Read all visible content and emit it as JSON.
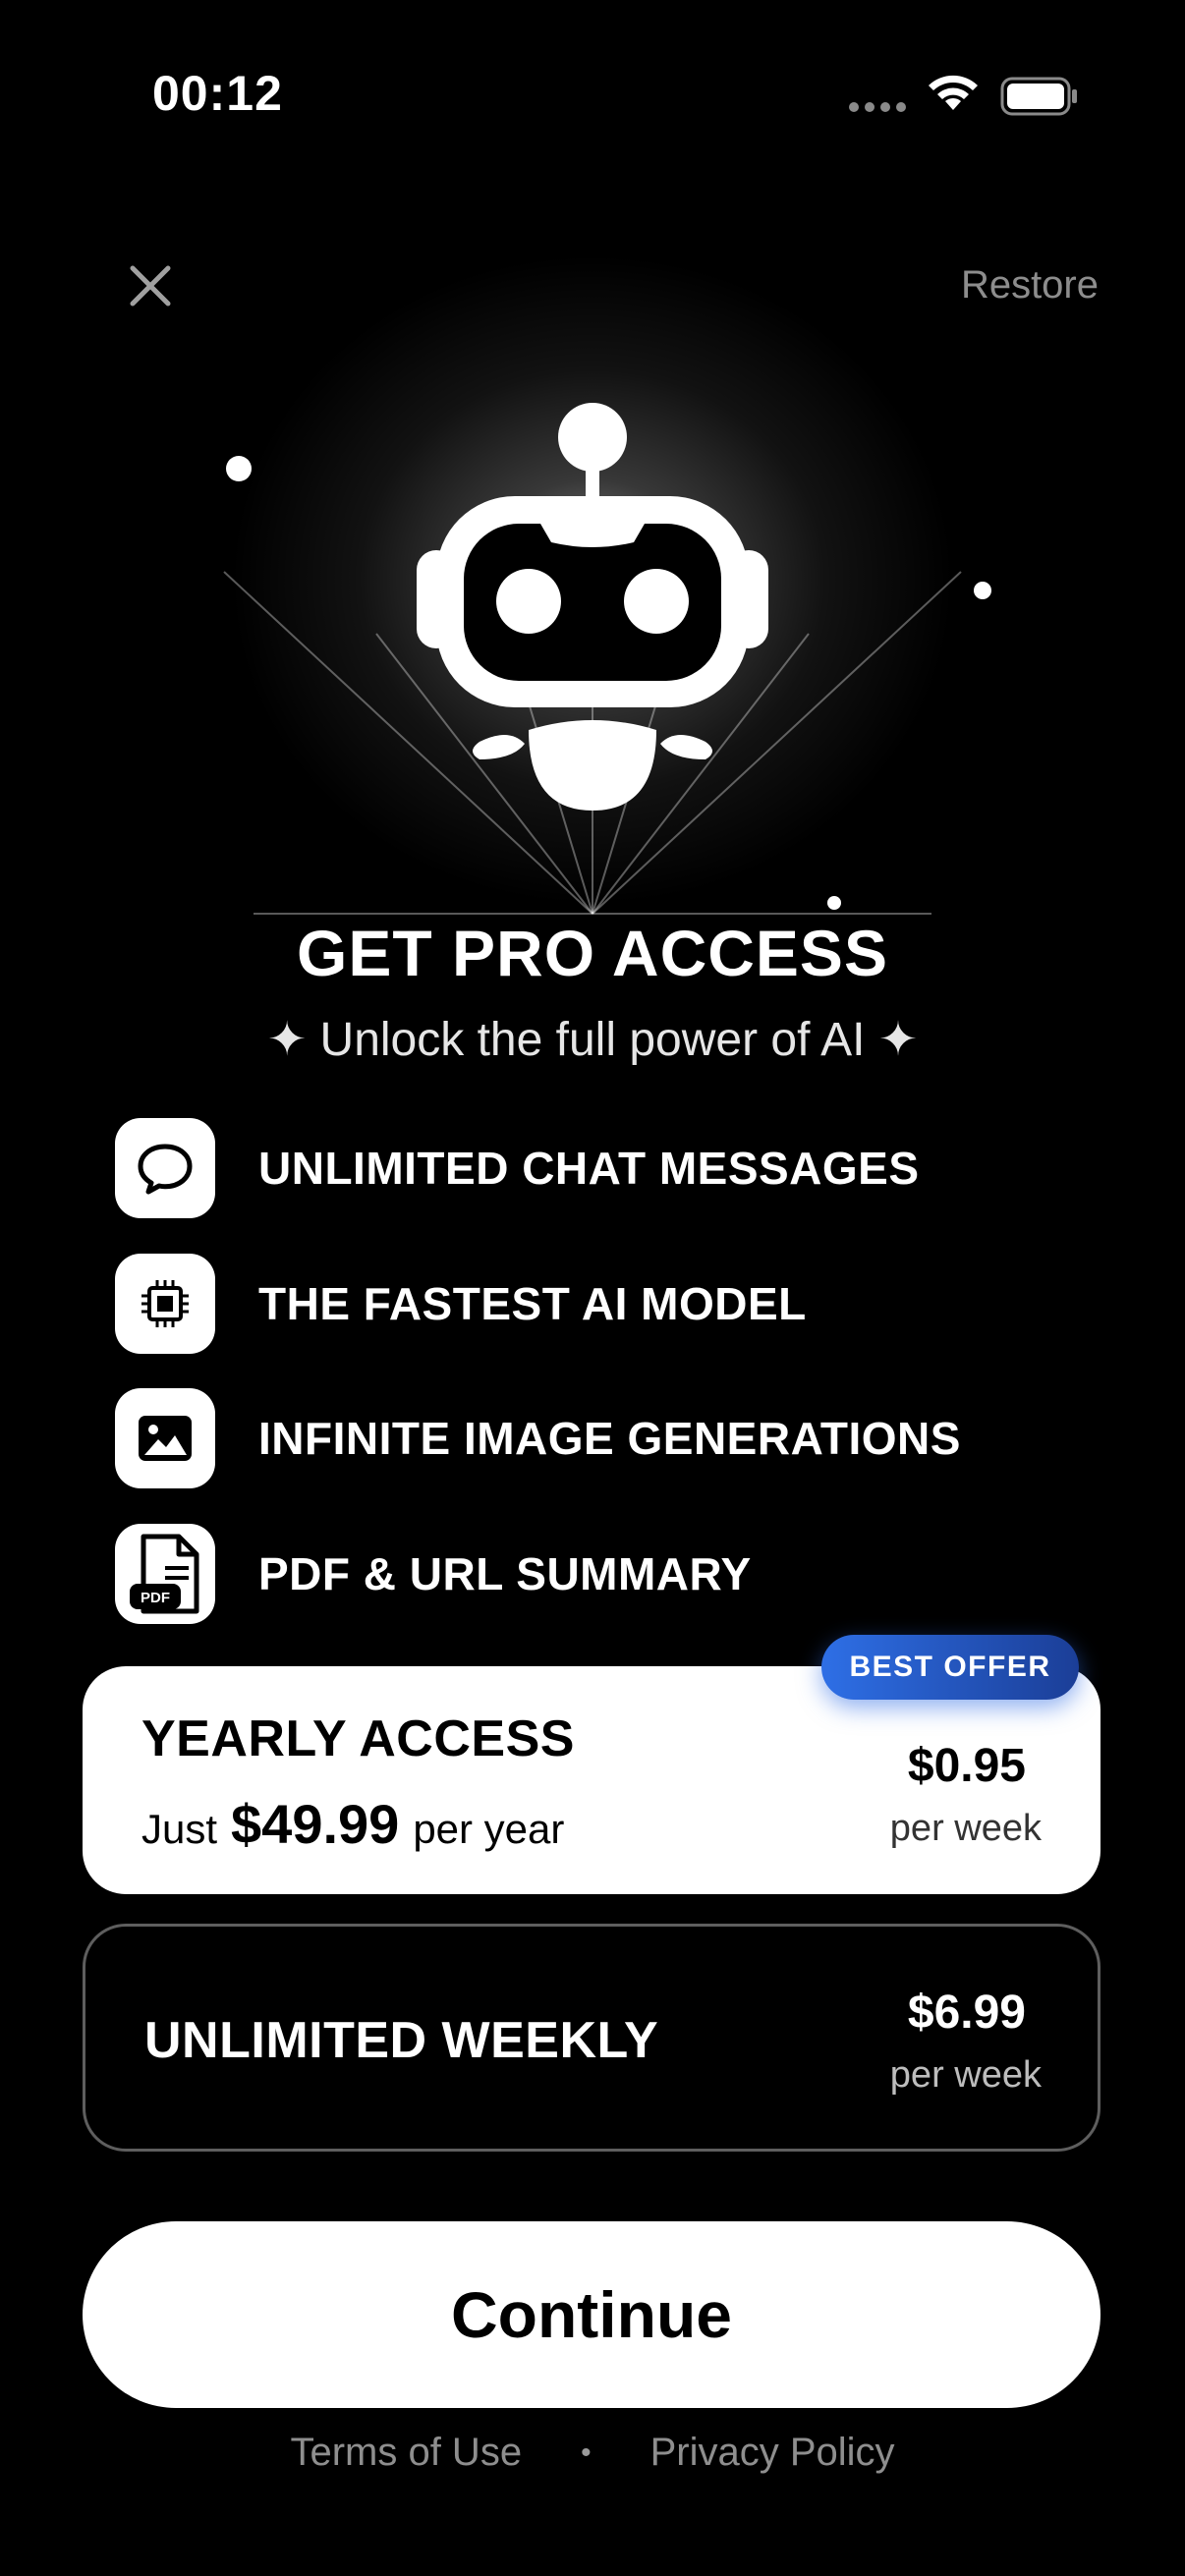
{
  "status_bar": {
    "time": "00:12"
  },
  "header": {
    "restore_label": "Restore"
  },
  "hero": {
    "title": "GET PRO ACCESS",
    "subtitle": "✦ Unlock the full power of AI ✦"
  },
  "features": [
    {
      "icon": "chat-bubble-icon",
      "label": "UNLIMITED CHAT MESSAGES"
    },
    {
      "icon": "cpu-chip-icon",
      "label": "THE FASTEST AI MODEL"
    },
    {
      "icon": "image-icon",
      "label": "INFINITE IMAGE GENERATIONS"
    },
    {
      "icon": "pdf-document-icon",
      "label": "PDF & URL SUMMARY"
    }
  ],
  "plans": {
    "yearly": {
      "badge": "BEST OFFER",
      "name": "YEARLY ACCESS",
      "desc_prefix": "Just",
      "desc_price": "$49.99",
      "desc_suffix": "per year",
      "price": "$0.95",
      "per": "per week"
    },
    "weekly": {
      "name": "UNLIMITED WEEKLY",
      "price": "$6.99",
      "per": "per week"
    }
  },
  "continue_label": "Continue",
  "footer": {
    "terms": "Terms of Use",
    "separator": "•",
    "privacy": "Privacy Policy"
  },
  "colors": {
    "background": "#000000",
    "badge_start": "#2e6fe6",
    "badge_end": "#1b3e97",
    "muted_text": "#8e8e8e"
  }
}
